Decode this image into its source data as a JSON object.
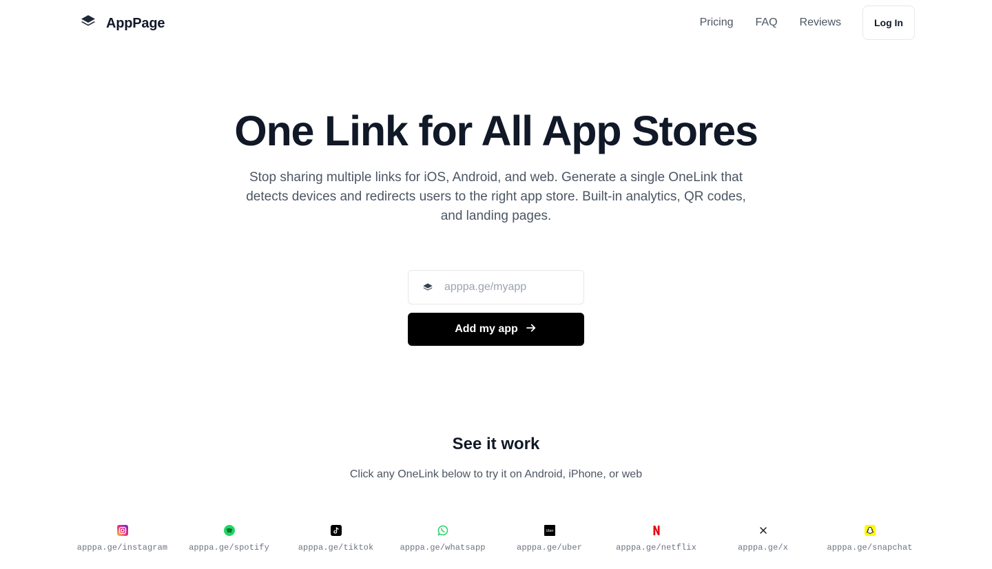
{
  "brand": {
    "name": "AppPage",
    "icon": "layers-icon"
  },
  "nav": {
    "links": [
      "Pricing",
      "FAQ",
      "Reviews"
    ],
    "login_label": "Log In"
  },
  "hero": {
    "title": "One Link for All App Stores",
    "subtitle": "Stop sharing multiple links for iOS, Android, and web. Generate a single OneLink that detects devices and redirects users to the right app store. Built-in analytics, QR codes, and landing pages.",
    "input": {
      "placeholder": "apppa.ge/myapp",
      "value": "",
      "icon": "layers-icon"
    },
    "cta_label": "Add my app",
    "cta_icon": "arrow-right-icon"
  },
  "demo": {
    "title": "See it work",
    "subtitle": "Click any OneLink below to try it on Android, iPhone, or web",
    "links": [
      {
        "url": "apppa.ge/instagram",
        "icon": "instagram-icon"
      },
      {
        "url": "apppa.ge/spotify",
        "icon": "spotify-icon"
      },
      {
        "url": "apppa.ge/tiktok",
        "icon": "tiktok-icon"
      },
      {
        "url": "apppa.ge/whatsapp",
        "icon": "whatsapp-icon"
      },
      {
        "url": "apppa.ge/uber",
        "icon": "uber-icon"
      },
      {
        "url": "apppa.ge/netflix",
        "icon": "netflix-icon"
      },
      {
        "url": "apppa.ge/x",
        "icon": "x-icon"
      },
      {
        "url": "apppa.ge/snapchat",
        "icon": "snapchat-icon"
      }
    ]
  },
  "colors": {
    "text_primary": "#111827",
    "text_secondary": "#4b5563",
    "button_bg": "#000000",
    "border": "#e5e7eb"
  }
}
